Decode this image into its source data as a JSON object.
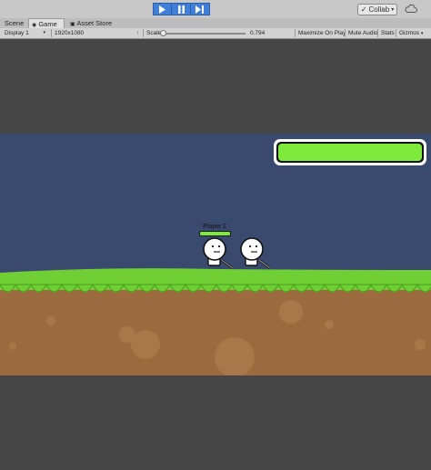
{
  "toolbar": {
    "play_icon": "play-icon",
    "pause_icon": "pause-icon",
    "step_icon": "step-icon",
    "collab_label": "Collab",
    "collab_check_icon": "check-icon",
    "cloud_icon": "cloud-icon"
  },
  "tabs": [
    {
      "label": "Scene"
    },
    {
      "label": "Game"
    },
    {
      "label": "Asset Store"
    }
  ],
  "options": {
    "display": "Display 1",
    "resolution": "1920x1080",
    "scale_label": "Scale",
    "scale_value": "0.794",
    "maximize_label": "Maximize On Play",
    "mute_label": "Mute Audio",
    "stats_label": "Stats",
    "gizmos_label": "Gizmos"
  },
  "game": {
    "player_label": "Player 2",
    "colors": {
      "sky": "#3a4a6e",
      "grass": "#6fcf35",
      "grass_dark": "#4ea61f",
      "dirt": "#9b6a3f",
      "health": "#7eea3c",
      "letterbox": "#474747"
    }
  }
}
